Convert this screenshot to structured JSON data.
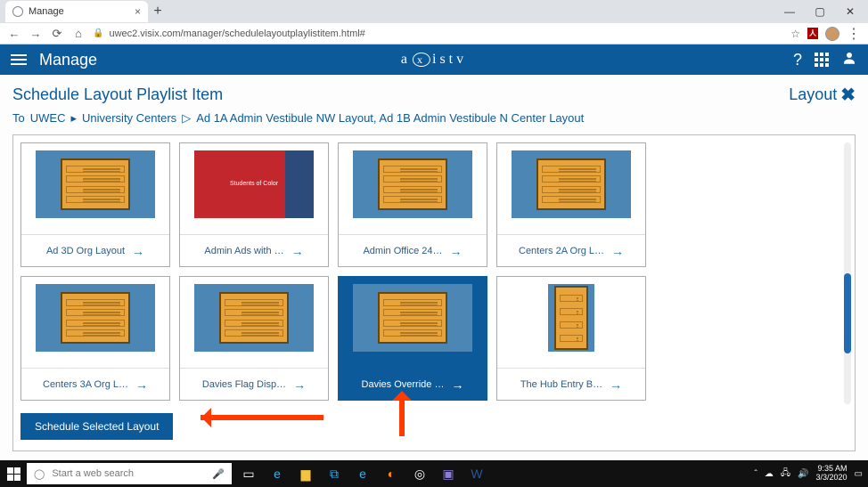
{
  "browser": {
    "tab_title": "Manage",
    "url": "uwec2.visix.com/manager/schedulelayoutplaylistitem.html#"
  },
  "header": {
    "app_title": "Manage",
    "brand_left": "a",
    "brand_x": "x",
    "brand_right": "istv",
    "help": "?"
  },
  "page": {
    "title": "Schedule Layout Playlist Item",
    "layout_label": "Layout",
    "breadcrumb": {
      "to": "To",
      "root": "UWEC",
      "arrow": "▸",
      "level1": "University Centers",
      "sep": "▷",
      "level2": "Ad 1A Admin Vestibule NW Layout, Ad 1B Admin Vestibule N Center Layout"
    },
    "schedule_button": "Schedule Selected Layout"
  },
  "layouts": [
    {
      "label": "Ad 3D Org Layout",
      "type": "std",
      "selected": false
    },
    {
      "label": "Admin Ads with …",
      "type": "red",
      "selected": false,
      "red_text": "Students of Color"
    },
    {
      "label": "Admin Office 24…",
      "type": "std",
      "selected": false
    },
    {
      "label": "Centers 2A Org L…",
      "type": "std",
      "selected": false
    },
    {
      "label": "Centers 3A Org L…",
      "type": "std",
      "selected": false
    },
    {
      "label": "Davies Flag Disp…",
      "type": "std",
      "selected": false
    },
    {
      "label": "Davies Override …",
      "type": "std",
      "selected": true
    },
    {
      "label": "The Hub Entry B…",
      "type": "tall",
      "selected": false
    }
  ],
  "taskbar": {
    "search_placeholder": "Start a web search",
    "time": "9:35 AM",
    "date": "3/3/2020"
  }
}
